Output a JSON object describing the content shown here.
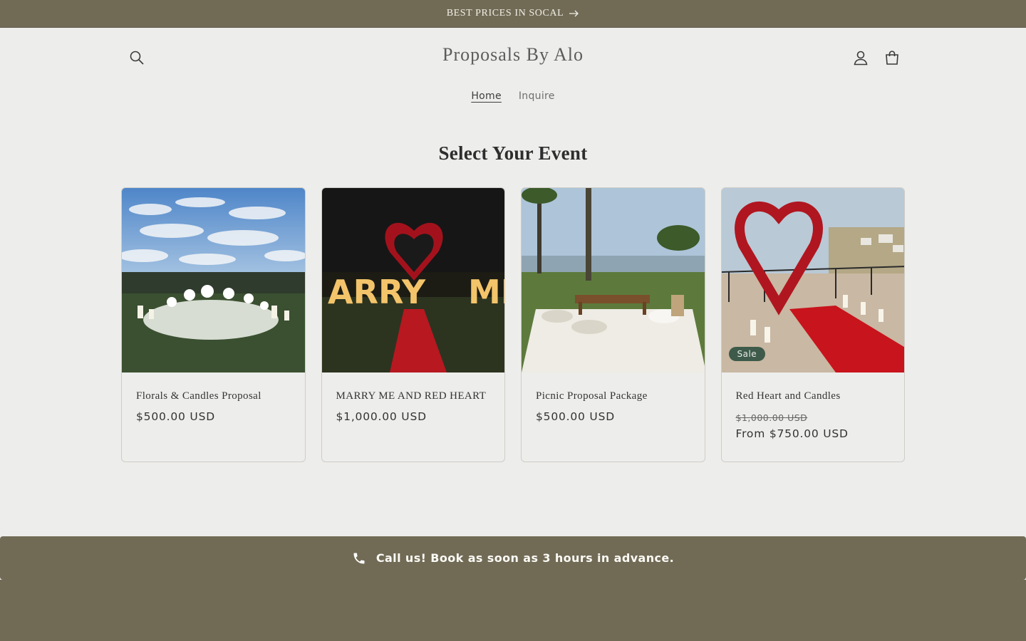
{
  "announcement": {
    "text": "BEST PRICES IN SOCAL"
  },
  "header": {
    "logo": "Proposals By Alo",
    "nav": [
      {
        "label": "Home",
        "active": true
      },
      {
        "label": "Inquire",
        "active": false
      }
    ]
  },
  "section": {
    "title": "Select Your Event"
  },
  "products": [
    {
      "title": "Florals & Candles Proposal",
      "price": "$500.00 USD",
      "image": "white-florals-and-candles-on-grass"
    },
    {
      "title": "MARRY ME AND RED HEART",
      "price": "$1,000.00 USD",
      "image": "marry-me-marquee-letters-red-heart-night"
    },
    {
      "title": "Picnic Proposal Package",
      "price": "$500.00 USD",
      "image": "oceanview-picnic-setup"
    },
    {
      "title": "Red Heart and Candles",
      "badge": "Sale",
      "compare_price": "$1,000.00 USD",
      "price": "From $750.00 USD",
      "image": "red-rose-heart-arch-with-candles"
    }
  ],
  "callbar": {
    "text": "Call us! Book as soon as 3 hours in advance.",
    "icon": "phone-icon"
  },
  "colors": {
    "accent": "#716b56",
    "background": "#ededeb",
    "sale_badge": "#3d5a4a"
  }
}
